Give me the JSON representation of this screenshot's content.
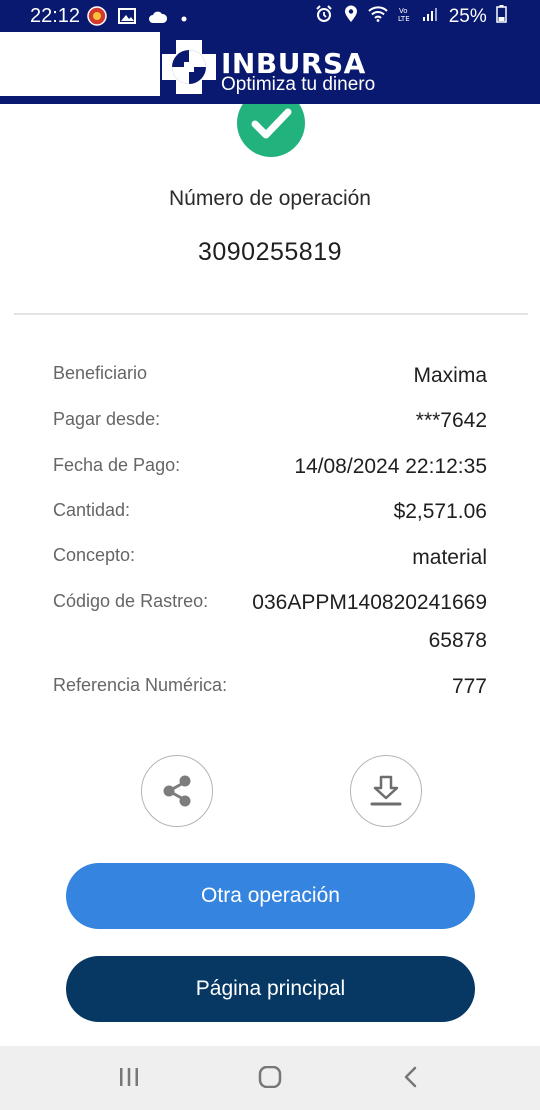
{
  "status_bar": {
    "time": "22:12",
    "battery_percent": "25%",
    "signal_label": "Vo LTE"
  },
  "brand": {
    "name": "INBURSA",
    "tagline": "Optimiza tu dinero"
  },
  "operation": {
    "label": "Número de operación",
    "number": "3090255819"
  },
  "details": [
    {
      "label": "Beneficiario",
      "value": "Maxima"
    },
    {
      "label": "Pagar desde:",
      "value": "***7642"
    },
    {
      "label": "Fecha de Pago:",
      "value": "14/08/2024 22:12:35"
    },
    {
      "label": "Cantidad:",
      "value": "$2,571.06"
    },
    {
      "label": "Concepto:",
      "value": "material"
    },
    {
      "label": "Código de Rastreo:",
      "value_line1": "036APPM140820241669",
      "value_line2": "65878"
    },
    {
      "label": "Referencia Numérica:",
      "value": "777"
    }
  ],
  "actions": {
    "share_icon": "share-icon",
    "download_icon": "download-icon"
  },
  "buttons": {
    "other_operation": "Otra operación",
    "main_page": "Página principal"
  },
  "colors": {
    "header": "#0a1970",
    "success": "#21b27d",
    "primary_button": "#3585e0",
    "dark_button": "#073864"
  }
}
